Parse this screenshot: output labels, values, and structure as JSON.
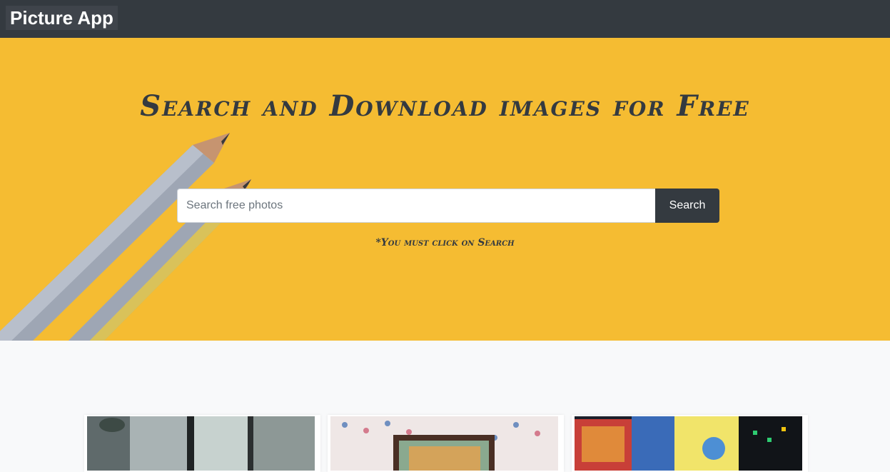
{
  "navbar": {
    "brand": "Picture App"
  },
  "hero": {
    "title": "Search and Download images for Free",
    "search_placeholder": "Search free photos",
    "search_value": "",
    "search_button": "Search",
    "hint": "*You must click on Search"
  },
  "colors": {
    "navbar": "#343a40",
    "hero_yellow": "#f4b92f",
    "button": "#343a40",
    "page_bg": "#f8f9fa"
  },
  "gallery": {
    "cards": [
      {
        "image": "window-interior-photo"
      },
      {
        "image": "framed-painting-on-floral-wallpaper-photo"
      },
      {
        "image": "city-billboards-at-night-photo"
      }
    ]
  }
}
